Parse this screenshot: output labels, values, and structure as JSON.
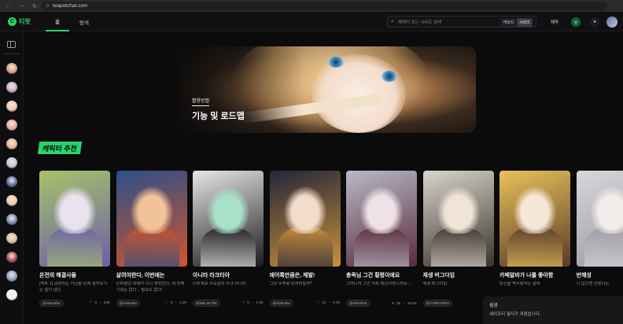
{
  "browser": {
    "url": "teapotchat.com"
  },
  "header": {
    "logo": "티팟",
    "tabs": [
      "홈",
      "탐색"
    ],
    "search_placeholder": "캐릭터 또는 시리즈 검색",
    "search_filters": [
      "캐릭터",
      "시리즈"
    ],
    "create_label": "제작",
    "icons": [
      "message-icon",
      "bell-icon",
      "avatar"
    ]
  },
  "banner": {
    "subtitle": "활용방법",
    "title": "기능 및 로드맵"
  },
  "section": {
    "title": "캐릭터 추천"
  },
  "cards": [
    {
      "name": "온전의 해결사들",
      "desc": "[액트 1] 금화라는 거금을 손에 넣어보기는 쉽지 않다.",
      "creator": "@Absinthe",
      "likes": "9",
      "chats": "23K",
      "heart": false,
      "c1": "#a6c36a",
      "c2": "#6d5fa8",
      "c3": "#e8e3ef"
    },
    {
      "name": "살려야한다, 이번에는",
      "desc": "은퇴했던 회에가 다시 재밌한다. 세 번째 기회는 없다... 필요도 없다!",
      "creator": "@Absinthe",
      "likes": "8",
      "chats": "1.3K",
      "heart": false,
      "c1": "#2b4f8a",
      "c2": "#d0552a",
      "c3": "#f2c39a"
    },
    {
      "name": "아니타 라크티아",
      "desc": "다트계요 수도원의 수녀 아니타",
      "creator": "@WiLJor784",
      "likes": "0",
      "chats": "2.3K",
      "heart": false,
      "c1": "#e7e7ea",
      "c2": "#1a1a1d",
      "c3": "#a9e0c8"
    },
    {
      "name": "에어록만큼은, 제발!",
      "desc": "그냥 우주로 던져버릴까?",
      "creator": "@Absinthe",
      "likes": "11",
      "chats": "9.2K",
      "heart": false,
      "c1": "#24263a",
      "c2": "#c98f3a",
      "c3": "#f3dccb"
    },
    {
      "name": "총독님 그건 횡령이에요",
      "desc": "그러니까 그건 저희 예산이라니까요...",
      "creator": "@Absinthe",
      "likes": "28",
      "chats": "18.5K",
      "heart": true,
      "c1": "#b7b9c8",
      "c2": "#5a2a3a",
      "c3": "#efe2e6"
    },
    {
      "name": "재생 버그다임",
      "desc": "재생 버그다임",
      "creator": "@YUREYENA",
      "likes": "0",
      "chats": "",
      "heart": false,
      "c1": "#d9d4cc",
      "c2": "#3a332c",
      "c3": "#efe4d6"
    },
    {
      "name": "카페알바가 나를 좋아함",
      "desc": "당신을 짝사랑하는 알바",
      "creator": "@Absinthe",
      "likes": "4",
      "chats": "1.0K",
      "heart": false,
      "c1": "#e8c25a",
      "c2": "#5a3a2a",
      "c3": "#f7e7d6"
    },
    {
      "name": "반혜성",
      "desc": "나 없으면 안된다는",
      "creator": "",
      "likes": "",
      "chats": "",
      "heart": false,
      "c1": "#d8d6db",
      "c2": "#9c9aa3",
      "c3": "#f2ecea"
    }
  ],
  "toast": {
    "title": "성공",
    "message": "세이프티 필터가 켜졌습니다."
  }
}
